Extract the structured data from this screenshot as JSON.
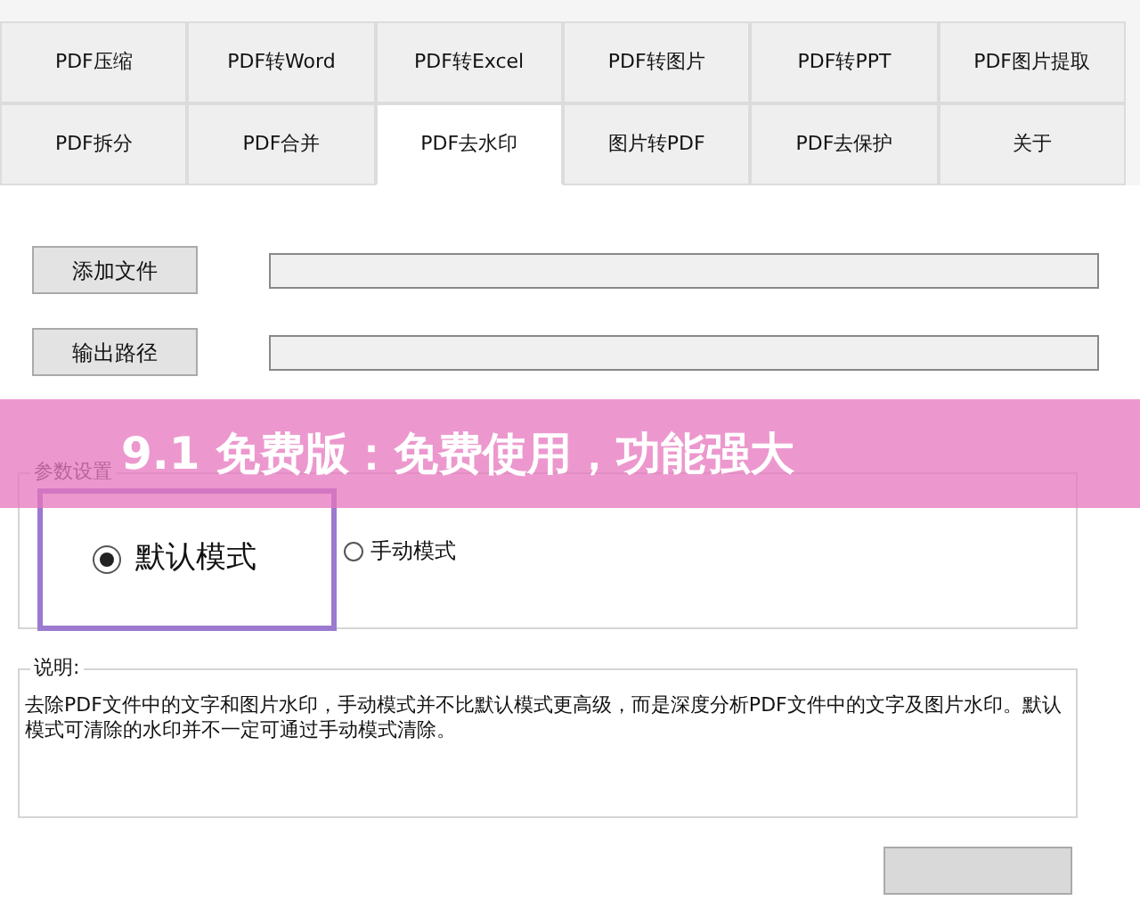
{
  "tabs": [
    {
      "label": "PDF压缩",
      "selected": false
    },
    {
      "label": "PDF转Word",
      "selected": false
    },
    {
      "label": "PDF转Excel",
      "selected": false
    },
    {
      "label": "PDF转图片",
      "selected": false
    },
    {
      "label": "PDF转PPT",
      "selected": false
    },
    {
      "label": "PDF图片提取",
      "selected": false
    },
    {
      "label": "PDF拆分",
      "selected": false
    },
    {
      "label": "PDF合并",
      "selected": false
    },
    {
      "label": "PDF去水印",
      "selected": true
    },
    {
      "label": "图片转PDF",
      "selected": false
    },
    {
      "label": "PDF去保护",
      "selected": false
    },
    {
      "label": "关于",
      "selected": false
    }
  ],
  "file_rows": [
    {
      "button": "添加文件"
    },
    {
      "button": "输出路径"
    }
  ],
  "settings": {
    "title": "参数设置",
    "modes": [
      {
        "label": "默认模式",
        "selected": true,
        "highlighted": true
      },
      {
        "label": "手动模式",
        "selected": false,
        "highlighted": false
      }
    ]
  },
  "description": {
    "title": "说明:",
    "text": "去除PDF文件中的文字和图片水印，手动模式并不比默认模式更高级，而是深度分析PDF文件中的文字及图片水印。默认模式可清除的水印并不一定可通过手动模式清除。"
  },
  "banner": {
    "text": "9.1 免费版：免费使用，功能强大"
  }
}
